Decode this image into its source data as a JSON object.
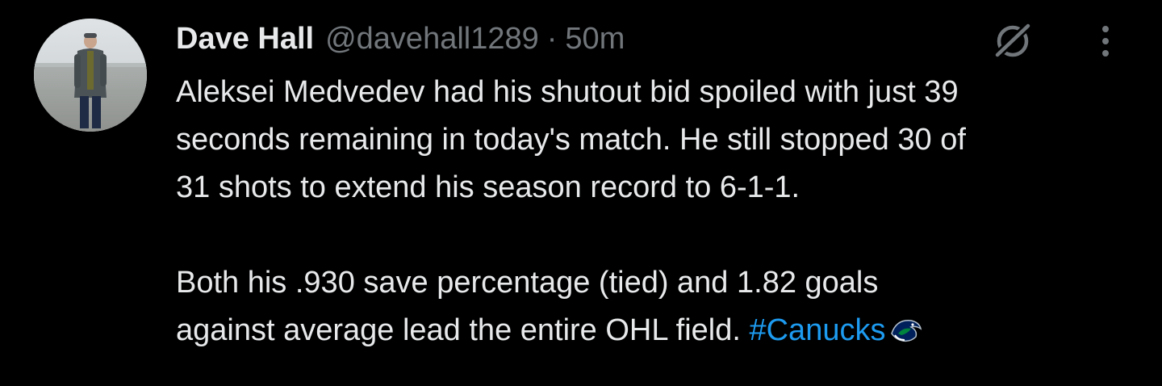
{
  "author": {
    "display_name": "Dave Hall",
    "handle": "@davehall1289",
    "separator": "·",
    "timestamp": "50m"
  },
  "tweet": {
    "lines_paragraph_1": [
      "Aleksei Medvedev had his shutout bid spoiled with just 39",
      "seconds remaining in today's match. He still stopped 30 of",
      "31 shots to extend his season record to 6-1-1."
    ],
    "paragraph_2_line_1": "Both his .930 save percentage (tied) and 1.82 goals",
    "paragraph_2_line_2_prefix": "against average lead the entire OHL field. ",
    "hashtag": "#Canucks"
  },
  "icons": {
    "grok": "grok-icon",
    "more": "more-options-icon",
    "hashflag": "canucks-orca-icon"
  },
  "colors": {
    "background": "#000000",
    "text_primary": "#e7e9ea",
    "text_secondary": "#71767b",
    "link": "#1d9bf0"
  }
}
